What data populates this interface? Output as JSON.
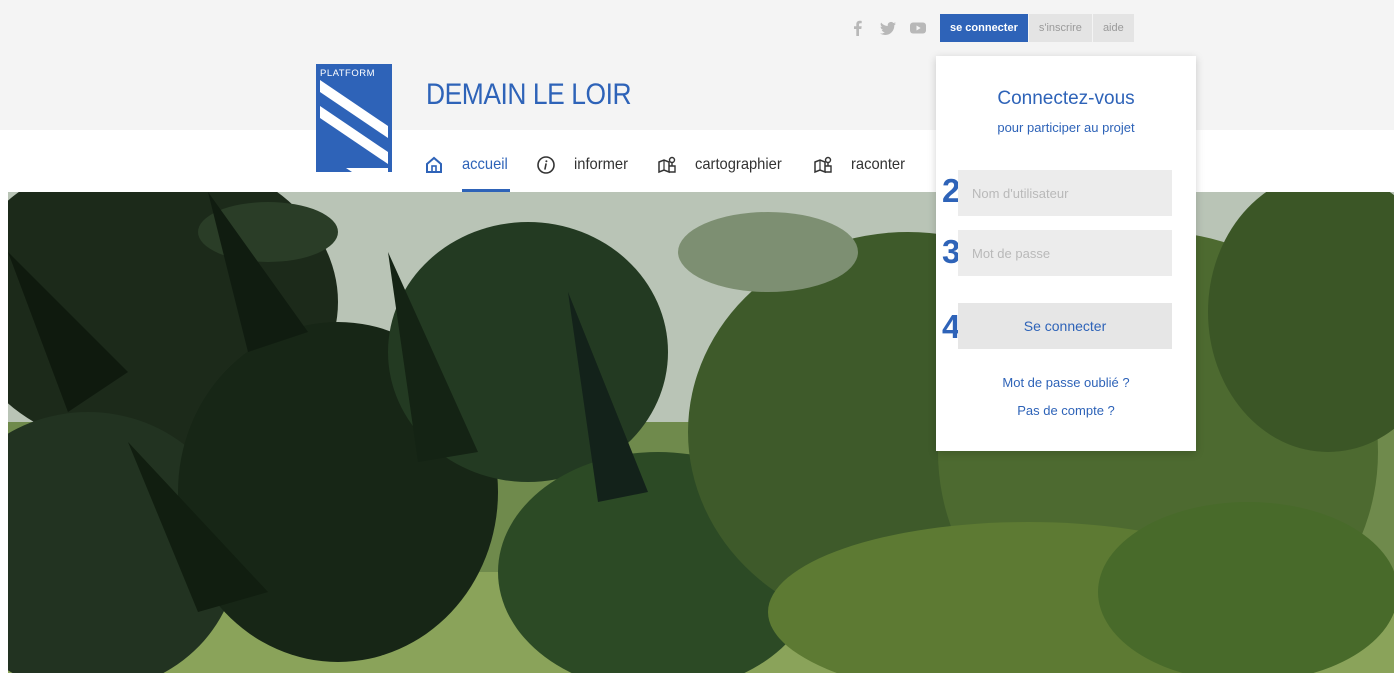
{
  "social": {
    "icons": [
      "facebook-icon",
      "twitter-icon",
      "youtube-icon"
    ]
  },
  "account_tabs": {
    "login": "se connecter",
    "signup": "s'inscrire",
    "help": "aide"
  },
  "logo": {
    "text": "PLATFORM"
  },
  "site": {
    "title": "DEMAIN LE LOIR"
  },
  "nav": {
    "items": [
      {
        "label": "accueil",
        "icon": "home-icon",
        "active": true
      },
      {
        "label": "informer",
        "icon": "info-icon",
        "active": false
      },
      {
        "label": "cartographier",
        "icon": "map-pin-icon",
        "active": false
      },
      {
        "label": "raconter",
        "icon": "map-pin-icon",
        "active": false
      }
    ]
  },
  "login": {
    "title": "Connectez-vous",
    "subtitle": "pour participer au projet",
    "username_placeholder": "Nom d'utilisateur",
    "password_placeholder": "Mot de passe",
    "submit_label": "Se connecter",
    "forgot_link": "Mot de passe oublié ?",
    "no_account_link": "Pas de compte ?",
    "step_labels": [
      "2",
      "3",
      "4"
    ]
  },
  "colors": {
    "brand_blue": "#2e63b8",
    "header_bg": "#f4f4f4",
    "tab_inactive_bg": "#e4e4e4",
    "field_bg": "#ececec"
  }
}
